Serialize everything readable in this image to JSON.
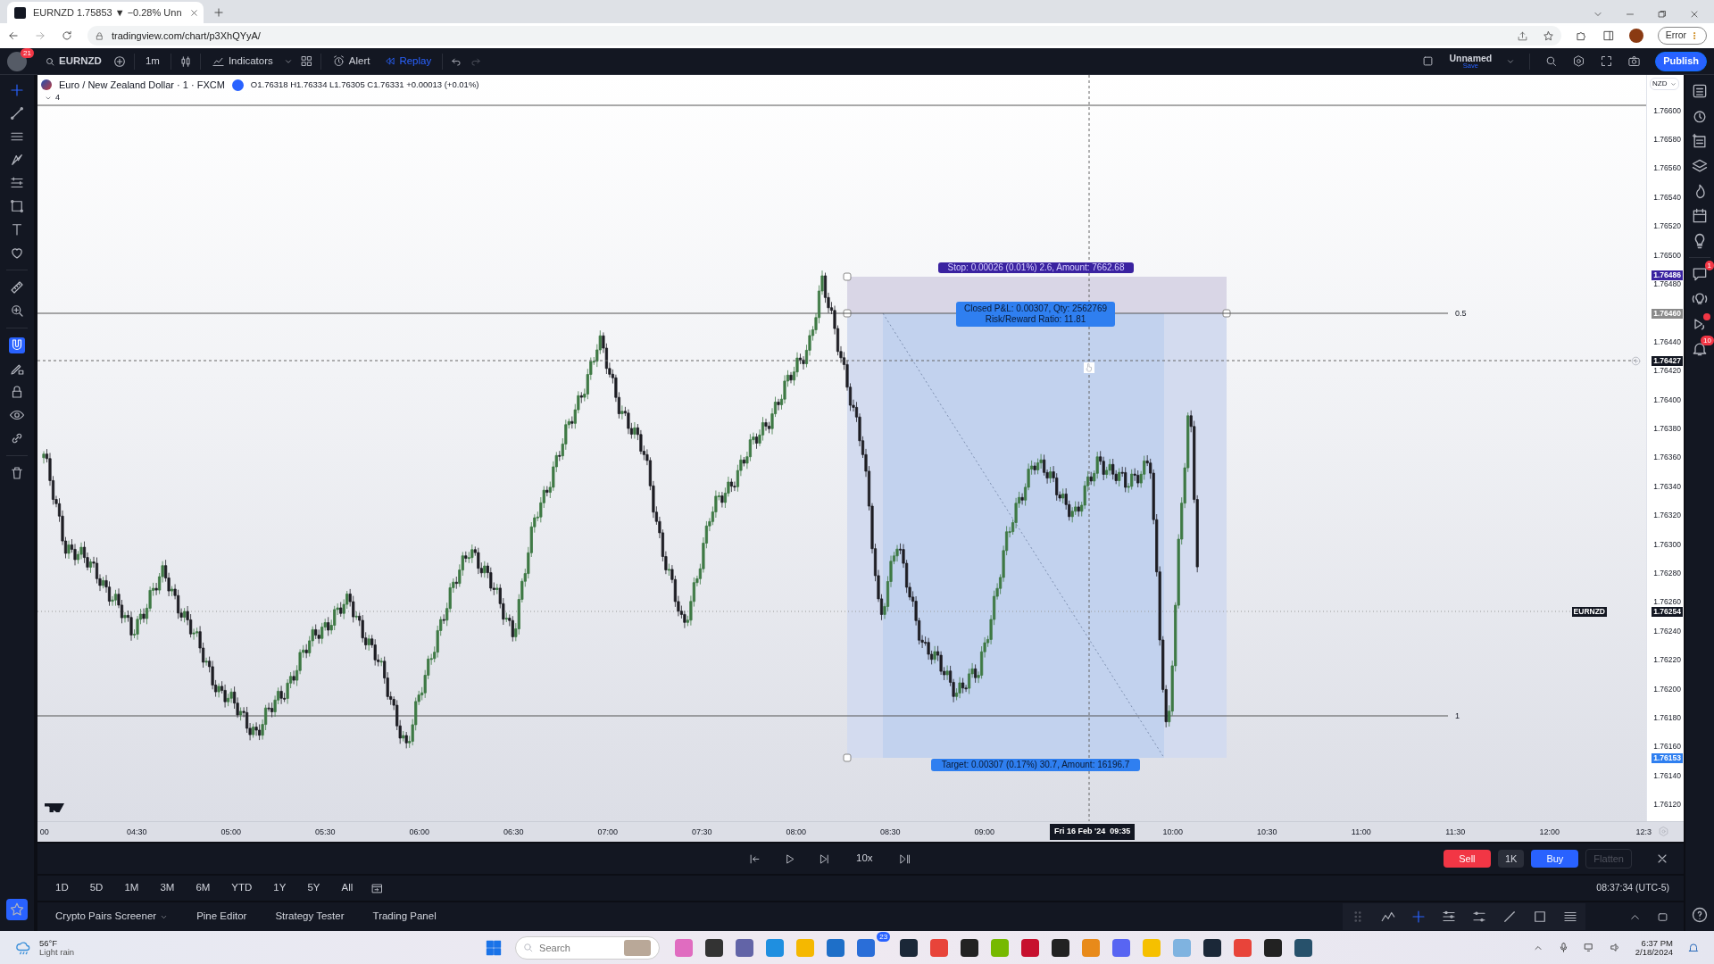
{
  "browser": {
    "tab_title": "EURNZD 1.75853 ▼ −0.28% Unn",
    "url": "tradingview.com/chart/p3XhQYyA/",
    "profile_button": "Error"
  },
  "toolbar": {
    "avatar_badge": "21",
    "symbol": "EURNZD",
    "interval": "1m",
    "indicators": "Indicators",
    "alert": "Alert",
    "replay": "Replay",
    "layout_name": "Unnamed",
    "layout_status": "Save",
    "publish": "Publish"
  },
  "legend": {
    "title": "Euro / New Zealand Dollar · 1 · FXCM",
    "ohlc": "O1.76318 H1.76334 L1.76305 C1.76331 +0.00013 (+0.01%)",
    "collapsed_count": "4"
  },
  "price_axis": {
    "currency": "NZD",
    "ticks": [
      "1.76600",
      "1.76580",
      "1.76560",
      "1.76540",
      "1.76520",
      "1.76500",
      "1.76480",
      "1.76440",
      "1.76420",
      "1.76400",
      "1.76380",
      "1.76360",
      "1.76340",
      "1.76320",
      "1.76300",
      "1.76280",
      "1.76260",
      "1.76240",
      "1.76220",
      "1.76200",
      "1.76180",
      "1.76160",
      "1.76140",
      "1.76120"
    ],
    "markers": [
      {
        "kind": "stop",
        "text": "1.76486"
      },
      {
        "kind": "entry",
        "text": "1.76460"
      },
      {
        "kind": "crosshair",
        "text": "1.76427"
      },
      {
        "kind": "last",
        "label": "EURNZD",
        "text": "1.76254"
      },
      {
        "kind": "target",
        "text": "1.76153"
      }
    ]
  },
  "time_axis": {
    "ticks": [
      "00",
      "04:30",
      "05:00",
      "05:30",
      "06:00",
      "06:30",
      "07:00",
      "07:30",
      "08:00",
      "08:30",
      "09:00",
      "10:00",
      "10:30",
      "11:00",
      "11:30",
      "12:00",
      "12:3"
    ],
    "crosshair_date": "Fri 16 Feb '24",
    "crosshair_time": "09:35"
  },
  "position": {
    "stop_label": "Stop: 0.00026 (0.01%) 2.6, Amount: 7662.68",
    "result_lines": [
      "Closed P&L: 0.00307, Qty: 2562769",
      "Risk/Reward Ratio: 11.81"
    ],
    "target_label": "Target: 0.00307 (0.17%) 30.7, Amount: 16196.7",
    "level_labels": [
      "0.5",
      "1"
    ]
  },
  "replay": {
    "speed": "10x",
    "sell": "Sell",
    "quantity": "1K",
    "buy": "Buy",
    "flatten": {
      "label": "Flatten",
      "disabled": true
    }
  },
  "ranges": [
    "1D",
    "5D",
    "1M",
    "3M",
    "6M",
    "YTD",
    "1Y",
    "5Y",
    "All"
  ],
  "clock": "08:37:34 (UTC-5)",
  "bottom_tabs": [
    "Crypto Pairs Screener",
    "Pine Editor",
    "Strategy Tester",
    "Trading Panel"
  ],
  "right_sidebar": {
    "chat_badge": "1",
    "alerts_badge": "10"
  },
  "taskbar": {
    "temperature": "56°F",
    "weather": "Light rain",
    "search_placeholder": "Search",
    "mail_badge": "23",
    "time": "6:37 PM",
    "date": "2/18/2024"
  }
}
